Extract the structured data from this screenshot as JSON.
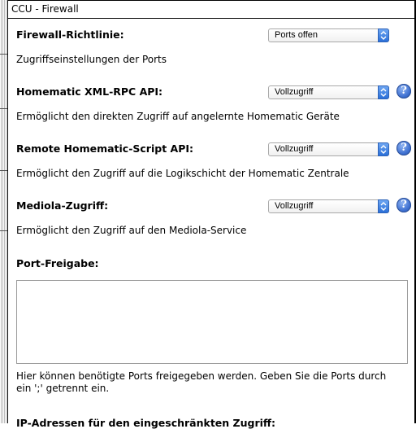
{
  "dialog": {
    "title": "CCU - Firewall"
  },
  "settings": [
    {
      "label": "Firewall-Richtlinie:",
      "select_value": "Ports offen",
      "description": "Zugriffseinstellungen der Ports",
      "help": false
    },
    {
      "label": "Homematic XML-RPC API:",
      "select_value": "Vollzugriff",
      "description": "Ermöglicht den direkten Zugriff auf angelernte Homematic Geräte",
      "help": true
    },
    {
      "label": "Remote Homematic-Script API:",
      "select_value": "Vollzugriff",
      "description": "Ermöglicht den Zugriff auf die Logikschicht der Homematic Zentrale",
      "help": true
    },
    {
      "label": "Mediola-Zugriff:",
      "select_value": "Vollzugriff",
      "description": "Ermöglicht den Zugriff auf den Mediola-Service",
      "help": true
    }
  ],
  "port_release": {
    "label": "Port-Freigabe:",
    "value": "",
    "description": "Hier können benötigte Ports freigegeben werden. Geben Sie die Ports durch ein ';' getrennt ein."
  },
  "ip_section": {
    "label": "IP-Adressen für den eingeschränkten Zugriff:"
  },
  "icons": {
    "help": "help-icon",
    "select_arrow": "chevron-updown-icon"
  },
  "colors": {
    "accent": "#2a6fd8",
    "help": "#3d6fd0"
  }
}
